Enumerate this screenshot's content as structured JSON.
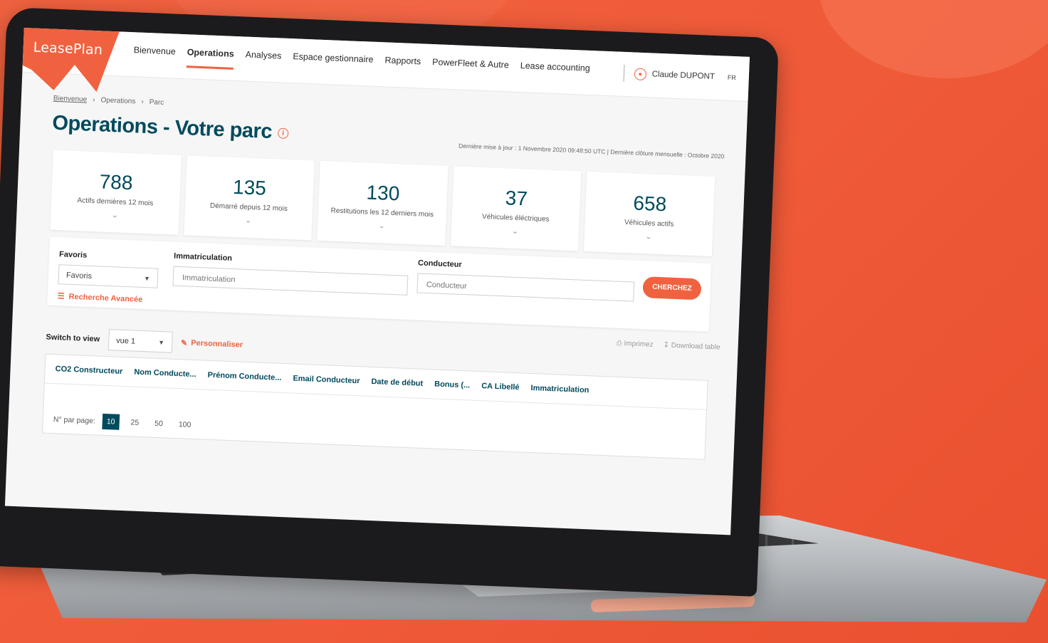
{
  "brand": {
    "name": "LeasePlan",
    "accent": "#f0623f",
    "primary": "#004a5d"
  },
  "nav": {
    "items": [
      {
        "label": "Bienvenue"
      },
      {
        "label": "Operations"
      },
      {
        "label": "Analyses"
      },
      {
        "label": "Espace gestionnaire"
      },
      {
        "label": "Rapports"
      },
      {
        "label": "PowerFleet & Autre"
      },
      {
        "label": "Lease accounting"
      }
    ],
    "active": "Operations"
  },
  "user": {
    "name": "Claude DUPONT",
    "lang": "FR",
    "icon": "user-icon"
  },
  "breadcrumb": [
    "Bienvenue",
    "Operations",
    "Parc"
  ],
  "page": {
    "title": "Operations - Votre parc",
    "update_text": "Dernière mise à jour : 1 Novembre 2020 09:48:50 UTC | Dernière clôture mensuelle : Octobre 2020"
  },
  "kpis": [
    {
      "value": "788",
      "label": "Actifs dernières 12 mois"
    },
    {
      "value": "135",
      "label": "Démarré depuis 12 mois"
    },
    {
      "value": "130",
      "label": "Restitutions les 12 derniers mois"
    },
    {
      "value": "37",
      "label": "Véhicules éléctriques"
    },
    {
      "value": "658",
      "label": "Véhicules actifs"
    }
  ],
  "search": {
    "favoris_label": "Favoris",
    "favoris_value": "Favoris",
    "immat_label": "Immatriculation",
    "immat_placeholder": "Immatriculation",
    "conducteur_label": "Conducteur",
    "conducteur_placeholder": "Conducteur",
    "submit": "CHERCHEZ",
    "advanced": "Recherche Avancée"
  },
  "view": {
    "switch_label": "Switch to view",
    "selected": "vue 1",
    "customize": "Personnaliser",
    "print": "Imprimez",
    "download": "Download table"
  },
  "table": {
    "columns": [
      "CO2 Constructeur",
      "Nom Conducte...",
      "Prénom Conducte...",
      "Email Conducteur",
      "Date de début",
      "Bonus (...",
      "CA Libellé",
      "Immatriculation"
    ]
  },
  "pagination": {
    "label": "N° par page:",
    "options": [
      "10",
      "25",
      "50",
      "100"
    ],
    "selected": "10"
  }
}
